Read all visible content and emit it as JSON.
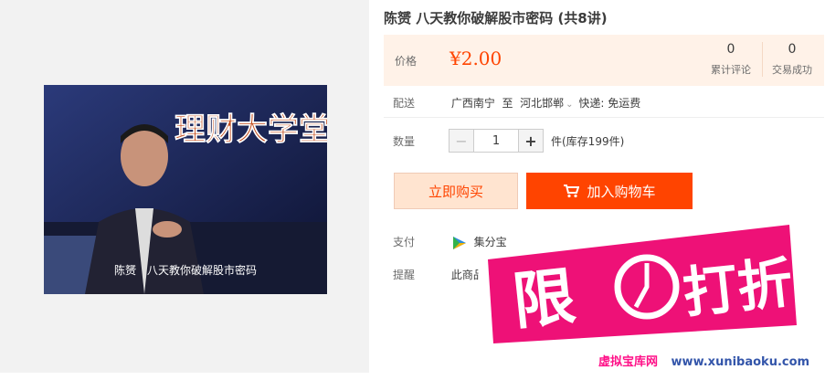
{
  "product": {
    "title": "陈赟 八天教你破解股市密码 (共8讲)",
    "video_logo": "理财大学堂",
    "video_caption": "陈赟　八天教你破解股市密码"
  },
  "price": {
    "label": "价格",
    "value": "¥2.00",
    "reviews_count": "0",
    "reviews_label": "累计评论",
    "deals_count": "0",
    "deals_label": "交易成功"
  },
  "delivery": {
    "label": "配送",
    "from": "广西南宁",
    "to_word": "至",
    "to": "河北邯郸",
    "shipping": "快递: 免运费"
  },
  "quantity": {
    "label": "数量",
    "minus": "−",
    "value": "1",
    "plus": "+",
    "stock": "件(库存199件)"
  },
  "actions": {
    "buy_now": "立即购买",
    "add_to_cart": "加入购物车"
  },
  "payment": {
    "label": "支付",
    "method": "集分宝"
  },
  "reminder": {
    "label": "提醒",
    "text": "此商品"
  },
  "promo_badge": {
    "text": "限时打折",
    "site_name": "虚拟宝库网",
    "site_url": "www.xunibaoku.com"
  },
  "colors": {
    "accent": "#ff4400",
    "price_bg": "#fff2e8",
    "badge_pink": "#ee1177"
  }
}
